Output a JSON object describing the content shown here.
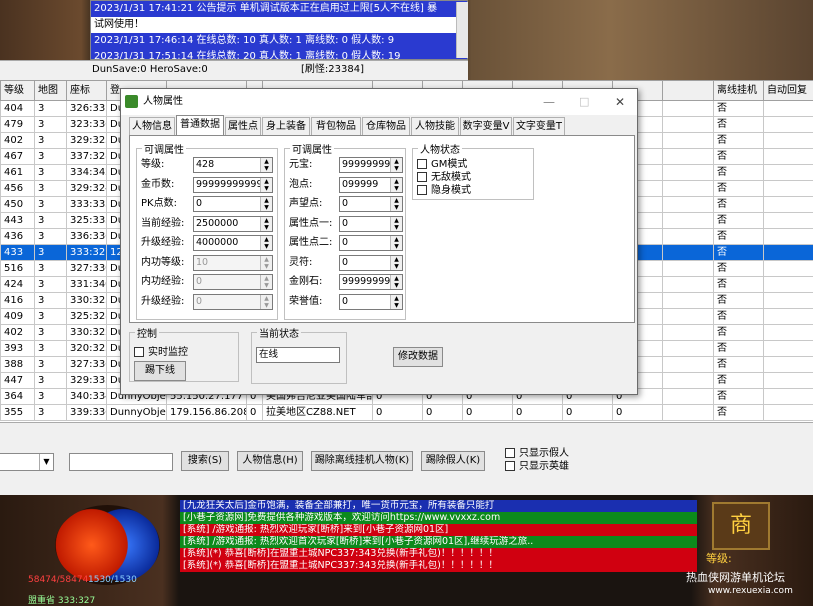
{
  "game_top": {
    "log": [
      {
        "text": "2023/1/31 17:41:21 公告提示 单机调试版本正在启用过上限[5人不在线] 暴",
        "style": "blue"
      },
      {
        "text": "试网使用！",
        "style": "white"
      },
      {
        "text": "2023/1/31 17:46:14 在线总数: 10 真人数: 1 离线数: 0 假人数: 9",
        "style": "blue"
      },
      {
        "text": "2023/1/31 17:51:14 在线总数: 20 真人数: 1 离线数: 0 假人数: 19",
        "style": "blue"
      }
    ],
    "status": {
      "left": "DunSave:0 HeroSave:0",
      "right": "[刷怪:23384]"
    }
  },
  "grid": {
    "columns": [
      "等级",
      "地图",
      "座标",
      "登"
    ],
    "right_columns": [
      "离线挂机",
      "自动回复"
    ],
    "rows": [
      {
        "level": "404",
        "map": "3",
        "coord": "326:331",
        "obj": "Dun",
        "off": "否"
      },
      {
        "level": "479",
        "map": "3",
        "coord": "323:336",
        "obj": "Dun",
        "off": "否"
      },
      {
        "level": "402",
        "map": "3",
        "coord": "329:325",
        "obj": "Dun",
        "off": "否"
      },
      {
        "level": "467",
        "map": "3",
        "coord": "337:328",
        "obj": "Dun",
        "off": "否"
      },
      {
        "level": "461",
        "map": "3",
        "coord": "334:342",
        "obj": "Dun",
        "off": "否"
      },
      {
        "level": "456",
        "map": "3",
        "coord": "329:324",
        "obj": "Dun",
        "off": "否"
      },
      {
        "level": "450",
        "map": "3",
        "coord": "333:333",
        "obj": "Dun",
        "off": "否"
      },
      {
        "level": "443",
        "map": "3",
        "coord": "325:335",
        "obj": "Dun",
        "off": "否"
      },
      {
        "level": "436",
        "map": "3",
        "coord": "336:336",
        "obj": "Dun",
        "off": "否"
      },
      {
        "level": "433",
        "map": "3",
        "coord": "333:327",
        "obj": "123",
        "off": "否",
        "selected": true
      },
      {
        "level": "516",
        "map": "3",
        "coord": "327:330",
        "obj": "Dun",
        "off": "否"
      },
      {
        "level": "424",
        "map": "3",
        "coord": "331:340",
        "obj": "Dun",
        "off": "否"
      },
      {
        "level": "416",
        "map": "3",
        "coord": "330:323",
        "obj": "Dun",
        "off": "否"
      },
      {
        "level": "409",
        "map": "3",
        "coord": "325:328",
        "obj": "Dun",
        "off": "否"
      },
      {
        "level": "402",
        "map": "3",
        "coord": "330:322",
        "obj": "Dun",
        "off": "否"
      },
      {
        "level": "393",
        "map": "3",
        "coord": "320:323",
        "obj": "Dun",
        "off": "否"
      },
      {
        "level": "388",
        "map": "3",
        "coord": "327:336",
        "obj": "Dun",
        "off": "否"
      },
      {
        "level": "447",
        "map": "3",
        "coord": "329:333",
        "obj": "Dun",
        "off": "否"
      },
      {
        "level": "364",
        "map": "3",
        "coord": "340:334",
        "obj": "DunnyObject",
        "ip": "55.150.27.177",
        "zero": "0",
        "region": "美国弗吉尼亚美国陆军部",
        "v1": "0",
        "v2": "0",
        "v3": "0",
        "v4": "0",
        "v5": "0",
        "v6": "0",
        "off": "否"
      },
      {
        "level": "355",
        "map": "3",
        "coord": "339:336",
        "obj": "DunnyObject",
        "ip": "179.156.86.208",
        "zero": "0",
        "region": "拉美地区CZ88.NET",
        "v1": "0",
        "v2": "0",
        "v3": "0",
        "v4": "0",
        "v5": "0",
        "v6": "0",
        "off": "否"
      }
    ]
  },
  "controls": {
    "search": "搜索(S)",
    "char_info": "人物信息(H)",
    "kick_offline": "踢除离线挂机人物(K)",
    "kick_fake": "踢除假人(K)",
    "only_fake": "只显示假人",
    "only_hero": "只显示英雄"
  },
  "chat": [
    {
      "text": "[九龙狂关太后]金币饱满，装备全部兼打，唯一货币元宝，所有装备只能打",
      "style": "blue"
    },
    {
      "text": "[小巷子资源网]免费提供各种游戏版本，欢迎访问https://www.vvxxz.com",
      "style": "green"
    },
    {
      "text": "[系统]  /游戏通报: 热烈欢迎玩家[断桥]来到[小巷子资源网01区]",
      "style": "red"
    },
    {
      "text": "[系统]  /游戏通报: 热烈欢迎首次玩家[断桥]来到[小巷子资源网01区],继续玩游之旅..",
      "style": "green"
    },
    {
      "text": "[系统](*) 恭喜[断桥]在盟重土城NPC337:343兑换(新手礼包)！！！！！！",
      "style": "red"
    },
    {
      "text": "[系统](*) 恭喜[断桥]在盟重土城NPC337:343兑换(新手礼包)！！！！！！",
      "style": "red"
    },
    {
      "text": "[系统](*) 恭喜[断桥]在盟重土城NPC337:343兑换(新手礼包)！！！！！！",
      "style": "red"
    }
  ],
  "hud": {
    "hp": "58474/58474",
    "mp": "1530/1530",
    "location": "盟重省 333:327",
    "level_label": "等级:",
    "watermark": "热血侠网游单机论坛",
    "watermark_url": "www.rexuexia.com"
  },
  "dialog": {
    "title": "人物属性",
    "tabs": [
      "人物信息",
      "普通数据",
      "属性点",
      "身上装备",
      "背包物品",
      "仓库物品",
      "人物技能",
      "数字变量V",
      "文字变量T"
    ],
    "active_tab": 1,
    "group1": {
      "label": "可调属性",
      "fields": [
        {
          "label": "等级:",
          "value": "428"
        },
        {
          "label": "金币数:",
          "value": "99999999999"
        },
        {
          "label": "PK点数:",
          "value": "0"
        },
        {
          "label": "当前经验:",
          "value": "2500000"
        },
        {
          "label": "升级经验:",
          "value": "4000000"
        },
        {
          "label": "内功等级:",
          "value": "10",
          "disabled": true
        },
        {
          "label": "内功经验:",
          "value": "0",
          "disabled": true
        },
        {
          "label": "升级经验:",
          "value": "0",
          "disabled": true
        }
      ]
    },
    "group2": {
      "label": "可调属性",
      "fields": [
        {
          "label": "元宝:",
          "value": "99999999"
        },
        {
          "label": "泡点:",
          "value": "099999"
        },
        {
          "label": "声望点:",
          "value": "0"
        },
        {
          "label": "属性点一:",
          "value": "0"
        },
        {
          "label": "属性点二:",
          "value": "0"
        },
        {
          "label": "灵符:",
          "value": "0"
        },
        {
          "label": "金刚石:",
          "value": "99999999"
        },
        {
          "label": "荣誉值:",
          "value": "0"
        }
      ]
    },
    "state": {
      "label": "人物状态",
      "options": [
        "GM模式",
        "无敌模式",
        "隐身模式"
      ]
    },
    "control": {
      "label": "控制",
      "realtime": "实时监控",
      "kick": "踢下线"
    },
    "current": {
      "label": "当前状态",
      "value": "在线"
    },
    "modify": "修改数据"
  }
}
